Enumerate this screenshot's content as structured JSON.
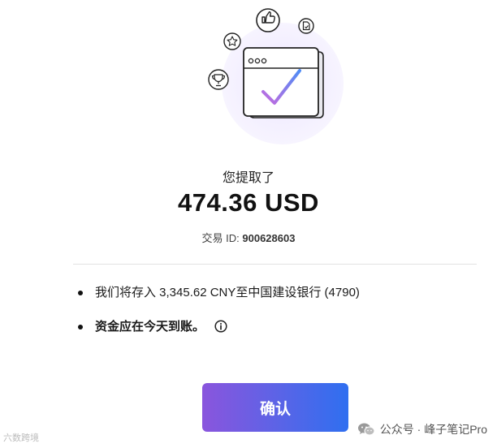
{
  "success": {
    "headline": "您提取了",
    "amount": "474.36 USD",
    "transaction_label": "交易 ID:",
    "transaction_id": "900628603"
  },
  "details": {
    "deposit_line": "我们将存入 3,345.62 CNY至中国建设银行 (4790)",
    "arrival_line": "资金应在今天到账。"
  },
  "actions": {
    "confirm_label": "确认"
  },
  "watermarks": {
    "left": "六数跨境",
    "right": "公众号 · 峰子笔记Pro"
  },
  "colors": {
    "button_gradient_start": "#8a55dd",
    "button_gradient_end": "#2f6ff0",
    "check_gradient_start": "#4f8cf5",
    "check_gradient_end": "#c56bdf",
    "halo": "#f2efff"
  },
  "icons": [
    "thumbs-up-icon",
    "star-icon",
    "trophy-icon",
    "document-icon",
    "browser-window-icon",
    "checkmark-icon",
    "info-icon",
    "wechat-icon"
  ]
}
